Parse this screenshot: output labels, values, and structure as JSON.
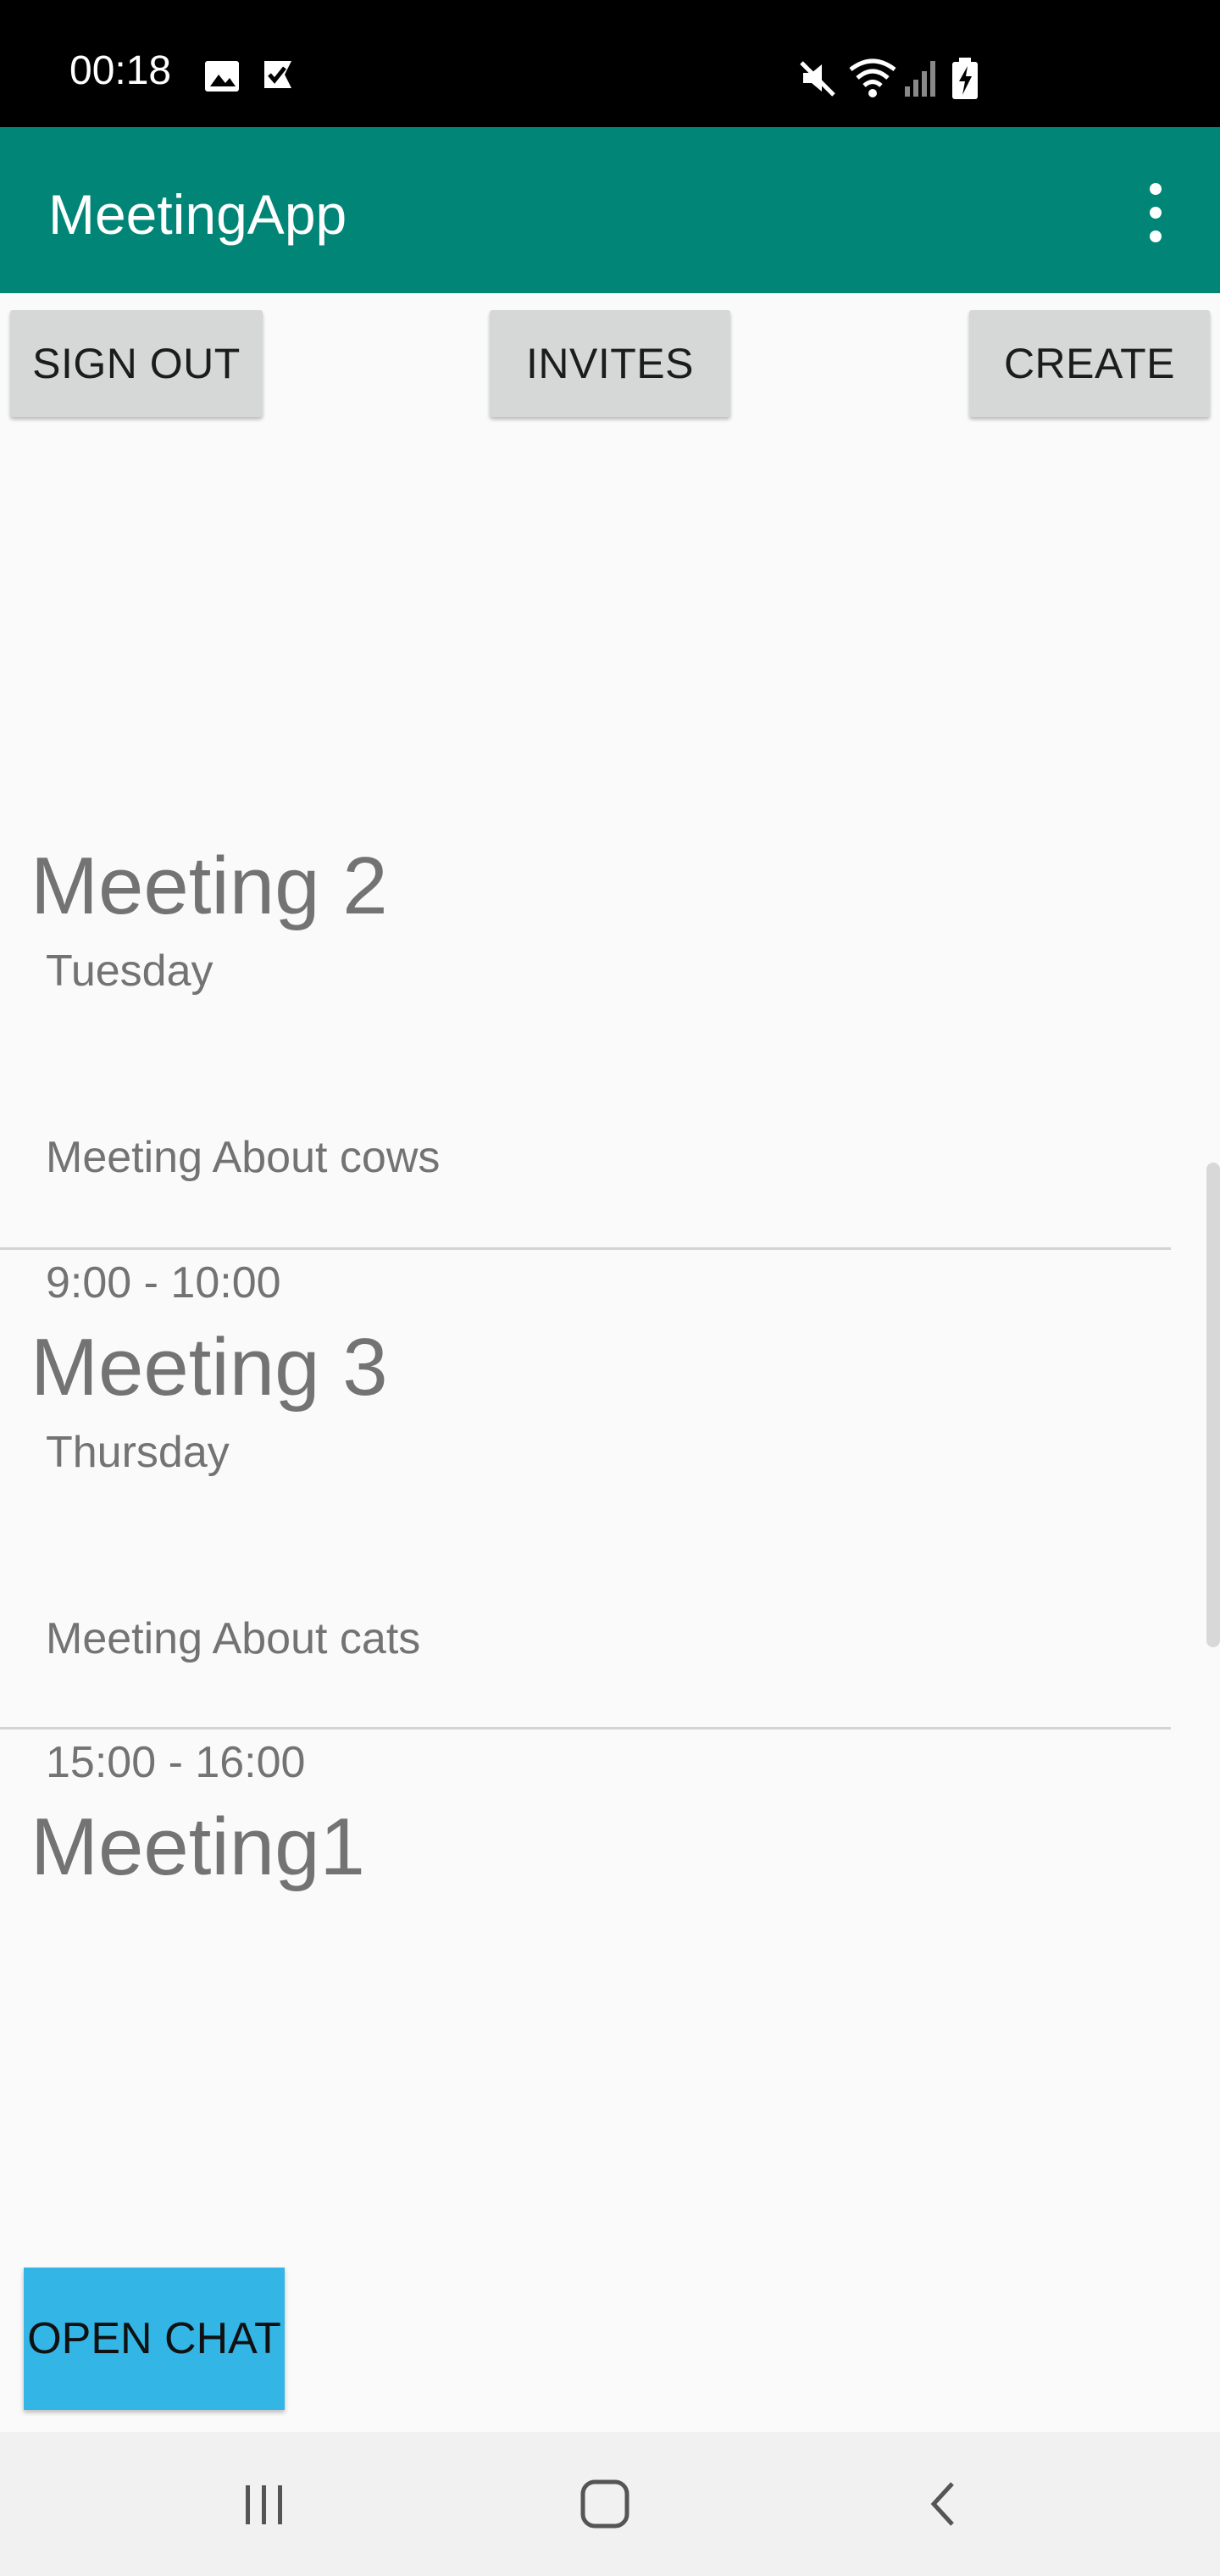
{
  "status_bar": {
    "time": "00:18",
    "icons": [
      "image-icon",
      "check-flag-icon",
      "mute-icon",
      "wifi-icon",
      "signal-icon",
      "battery-charging-icon"
    ]
  },
  "app_bar": {
    "title": "MeetingApp",
    "menu_icon": "overflow-menu-icon"
  },
  "toolbar": {
    "sign_out_label": "SIGN OUT",
    "invites_label": "INVITES",
    "create_label": "CREATE"
  },
  "meetings": [
    {
      "title": "Meeting 2",
      "day": "Tuesday",
      "description": "Meeting About cows",
      "time": "9:00 - 10:00"
    },
    {
      "title": "Meeting 3",
      "day": "Thursday",
      "description": "Meeting About cats",
      "time": "15:00 - 16:00"
    },
    {
      "title": "Meeting1"
    }
  ],
  "chat": {
    "open_label": "OPEN CHAT"
  },
  "nav_bar": {
    "icons": [
      "recent-apps-icon",
      "home-icon",
      "back-icon"
    ]
  },
  "colors": {
    "app_bar": "#008577",
    "chat_button": "#33b5e5",
    "button": "#d6d7d7",
    "text_secondary": "#737373"
  }
}
